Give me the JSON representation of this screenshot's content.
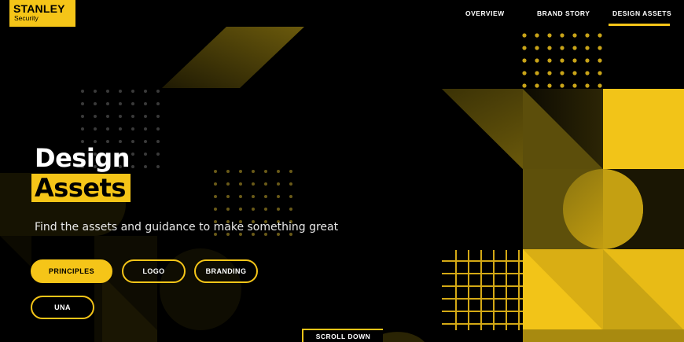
{
  "brand": {
    "name": "STANLEY",
    "sub": "Security",
    "color": "#f5c518"
  },
  "nav": {
    "items": [
      {
        "label": "OVERVIEW"
      },
      {
        "label": "BRAND STORY"
      },
      {
        "label": "DESIGN ASSETS",
        "active": true
      }
    ]
  },
  "hero": {
    "title_line1": "Design",
    "title_line2": "Assets",
    "subtitle": "Find the assets and guidance to make something great"
  },
  "buttons": {
    "principles": "PRINCIPLES",
    "logo": "LOGO",
    "branding": "BRANDING",
    "una": "UNA"
  },
  "scroll": {
    "label": "SCROLL DOWN"
  }
}
